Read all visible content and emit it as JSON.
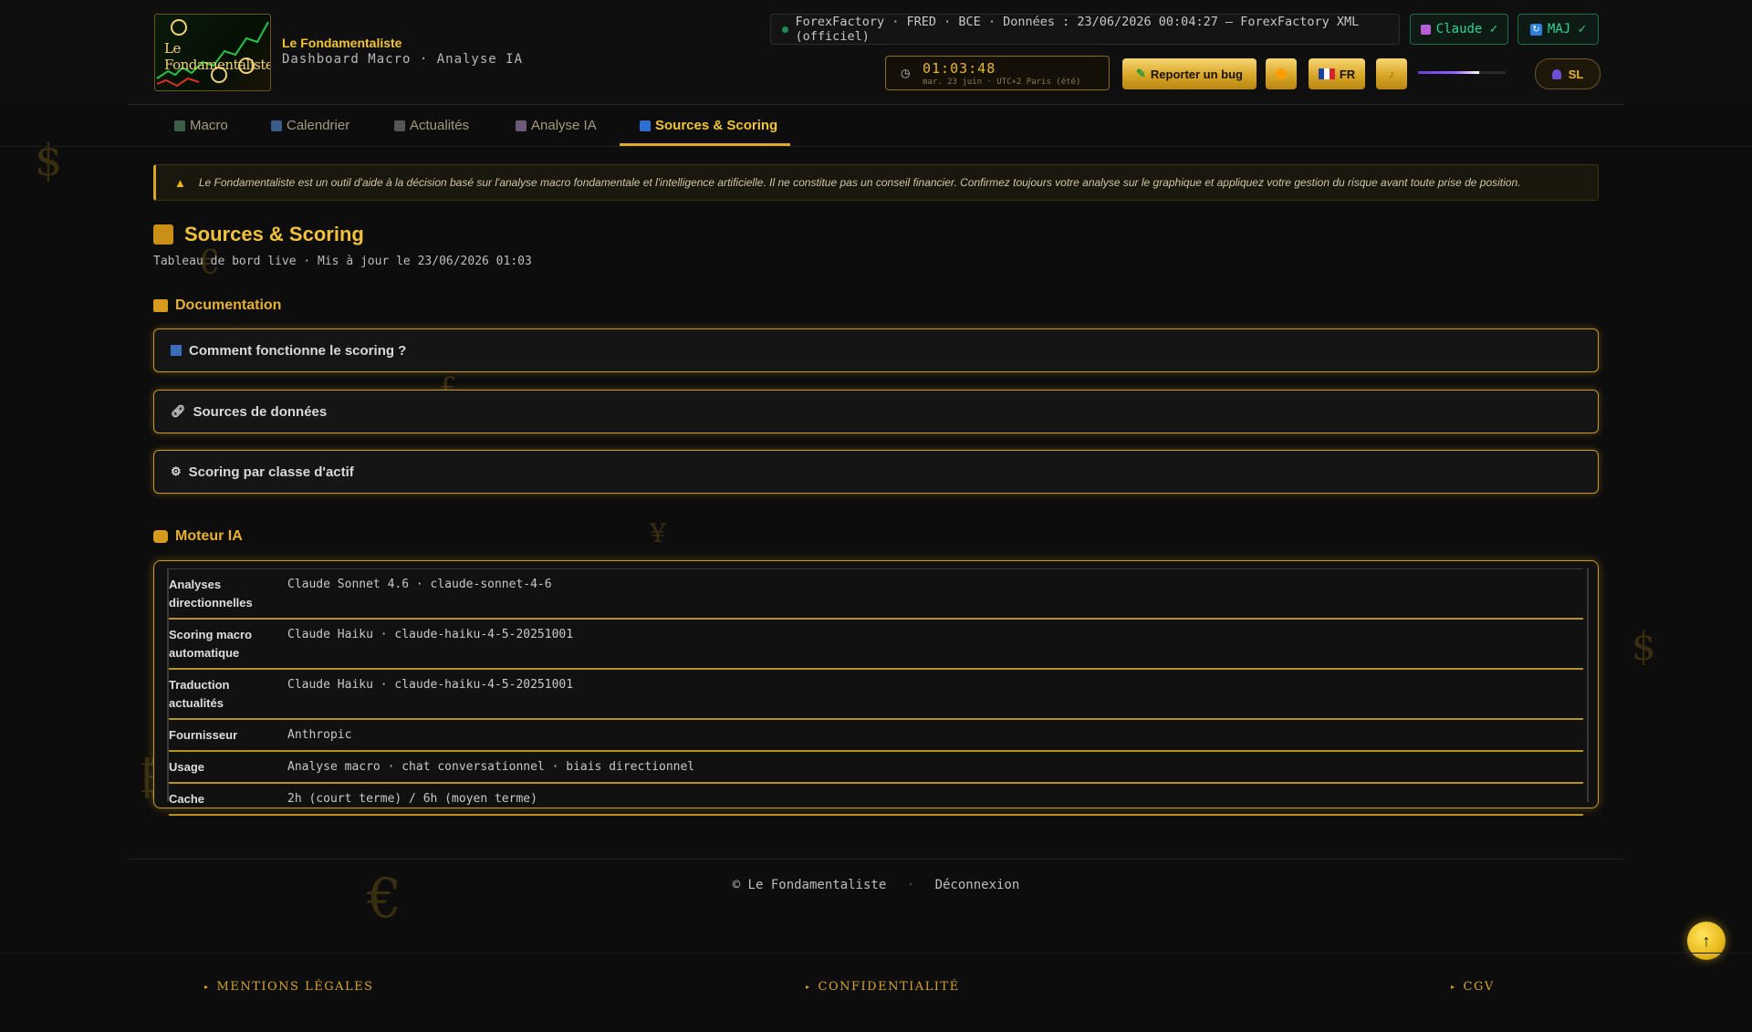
{
  "brand": {
    "name": "Le Fondamentaliste",
    "subtitle": "Dashboard Macro · Analyse IA",
    "logo_text": "Le Fondamentaliste"
  },
  "status": {
    "text": "ForexFactory · FRED · BCE · Données : 23/06/2026 00:04:27 — ForexFactory XML (officiel)"
  },
  "chips": {
    "claude": "Claude ✓",
    "maj": "MAJ ✓"
  },
  "clock": {
    "time": "01:03:48",
    "date": "mar. 23 juin · UTC+2 Paris (été)"
  },
  "toolbar": {
    "report_bug": "Reporter un bug",
    "lang": "FR"
  },
  "volume_level": 0.7,
  "user": {
    "initials": "SL"
  },
  "nav": {
    "tabs": [
      {
        "label": "Macro"
      },
      {
        "label": "Calendrier"
      },
      {
        "label": "Actualités"
      },
      {
        "label": "Analyse IA"
      },
      {
        "label": "Sources & Scoring"
      }
    ],
    "active": "Sources & Scoring"
  },
  "disclaimer": "Le Fondamentaliste est un outil d'aide à la décision basé sur l'analyse macro fondamentale et l'intelligence artificielle. Il ne constitue pas un conseil financier. Confirmez toujours votre analyse sur le graphique et appliquez votre gestion du risque avant toute prise de position.",
  "page": {
    "title": "Sources & Scoring",
    "subtitle": "Tableau de bord live · Mis à jour le 23/06/2026 01:03"
  },
  "documentation": {
    "title": "Documentation",
    "items": [
      {
        "icon": "chart-icon",
        "label": "Comment fonctionne le scoring ?"
      },
      {
        "icon": "link-icon",
        "label": "Sources de données"
      },
      {
        "icon": "gear-icon",
        "label": "Scoring par classe d'actif"
      }
    ]
  },
  "ai_engine": {
    "title": "Moteur IA",
    "rows": [
      {
        "key": "Analyses directionnelles",
        "value": "Claude Sonnet 4.6 · claude-sonnet-4-6"
      },
      {
        "key": "Scoring macro automatique",
        "value": "Claude Haiku · claude-haiku-4-5-20251001"
      },
      {
        "key": "Traduction actualités",
        "value": "Claude Haiku · claude-haiku-4-5-20251001"
      },
      {
        "key": "Fournisseur",
        "value": "Anthropic"
      },
      {
        "key": "Usage",
        "value": "Analyse macro · chat conversationnel · biais directionnel"
      },
      {
        "key": "Cache",
        "value": "2h (court terme) / 6h (moyen terme)"
      }
    ]
  },
  "footer": {
    "copyright": "© Le Fondamentaliste",
    "logout": "Déconnexion"
  },
  "legal": {
    "mentions": "MENTIONS LÉGALES",
    "privacy": "CONFIDENTIALITÉ",
    "cgv": "CGV"
  },
  "background_symbols": [
    "$",
    "€",
    "£",
    "¥",
    "$",
    "₿",
    "€"
  ],
  "colors": {
    "accent": "#f2c431",
    "gold": "#d6a52a",
    "green": "#2fd39a",
    "bg": "#0d0d0d"
  }
}
